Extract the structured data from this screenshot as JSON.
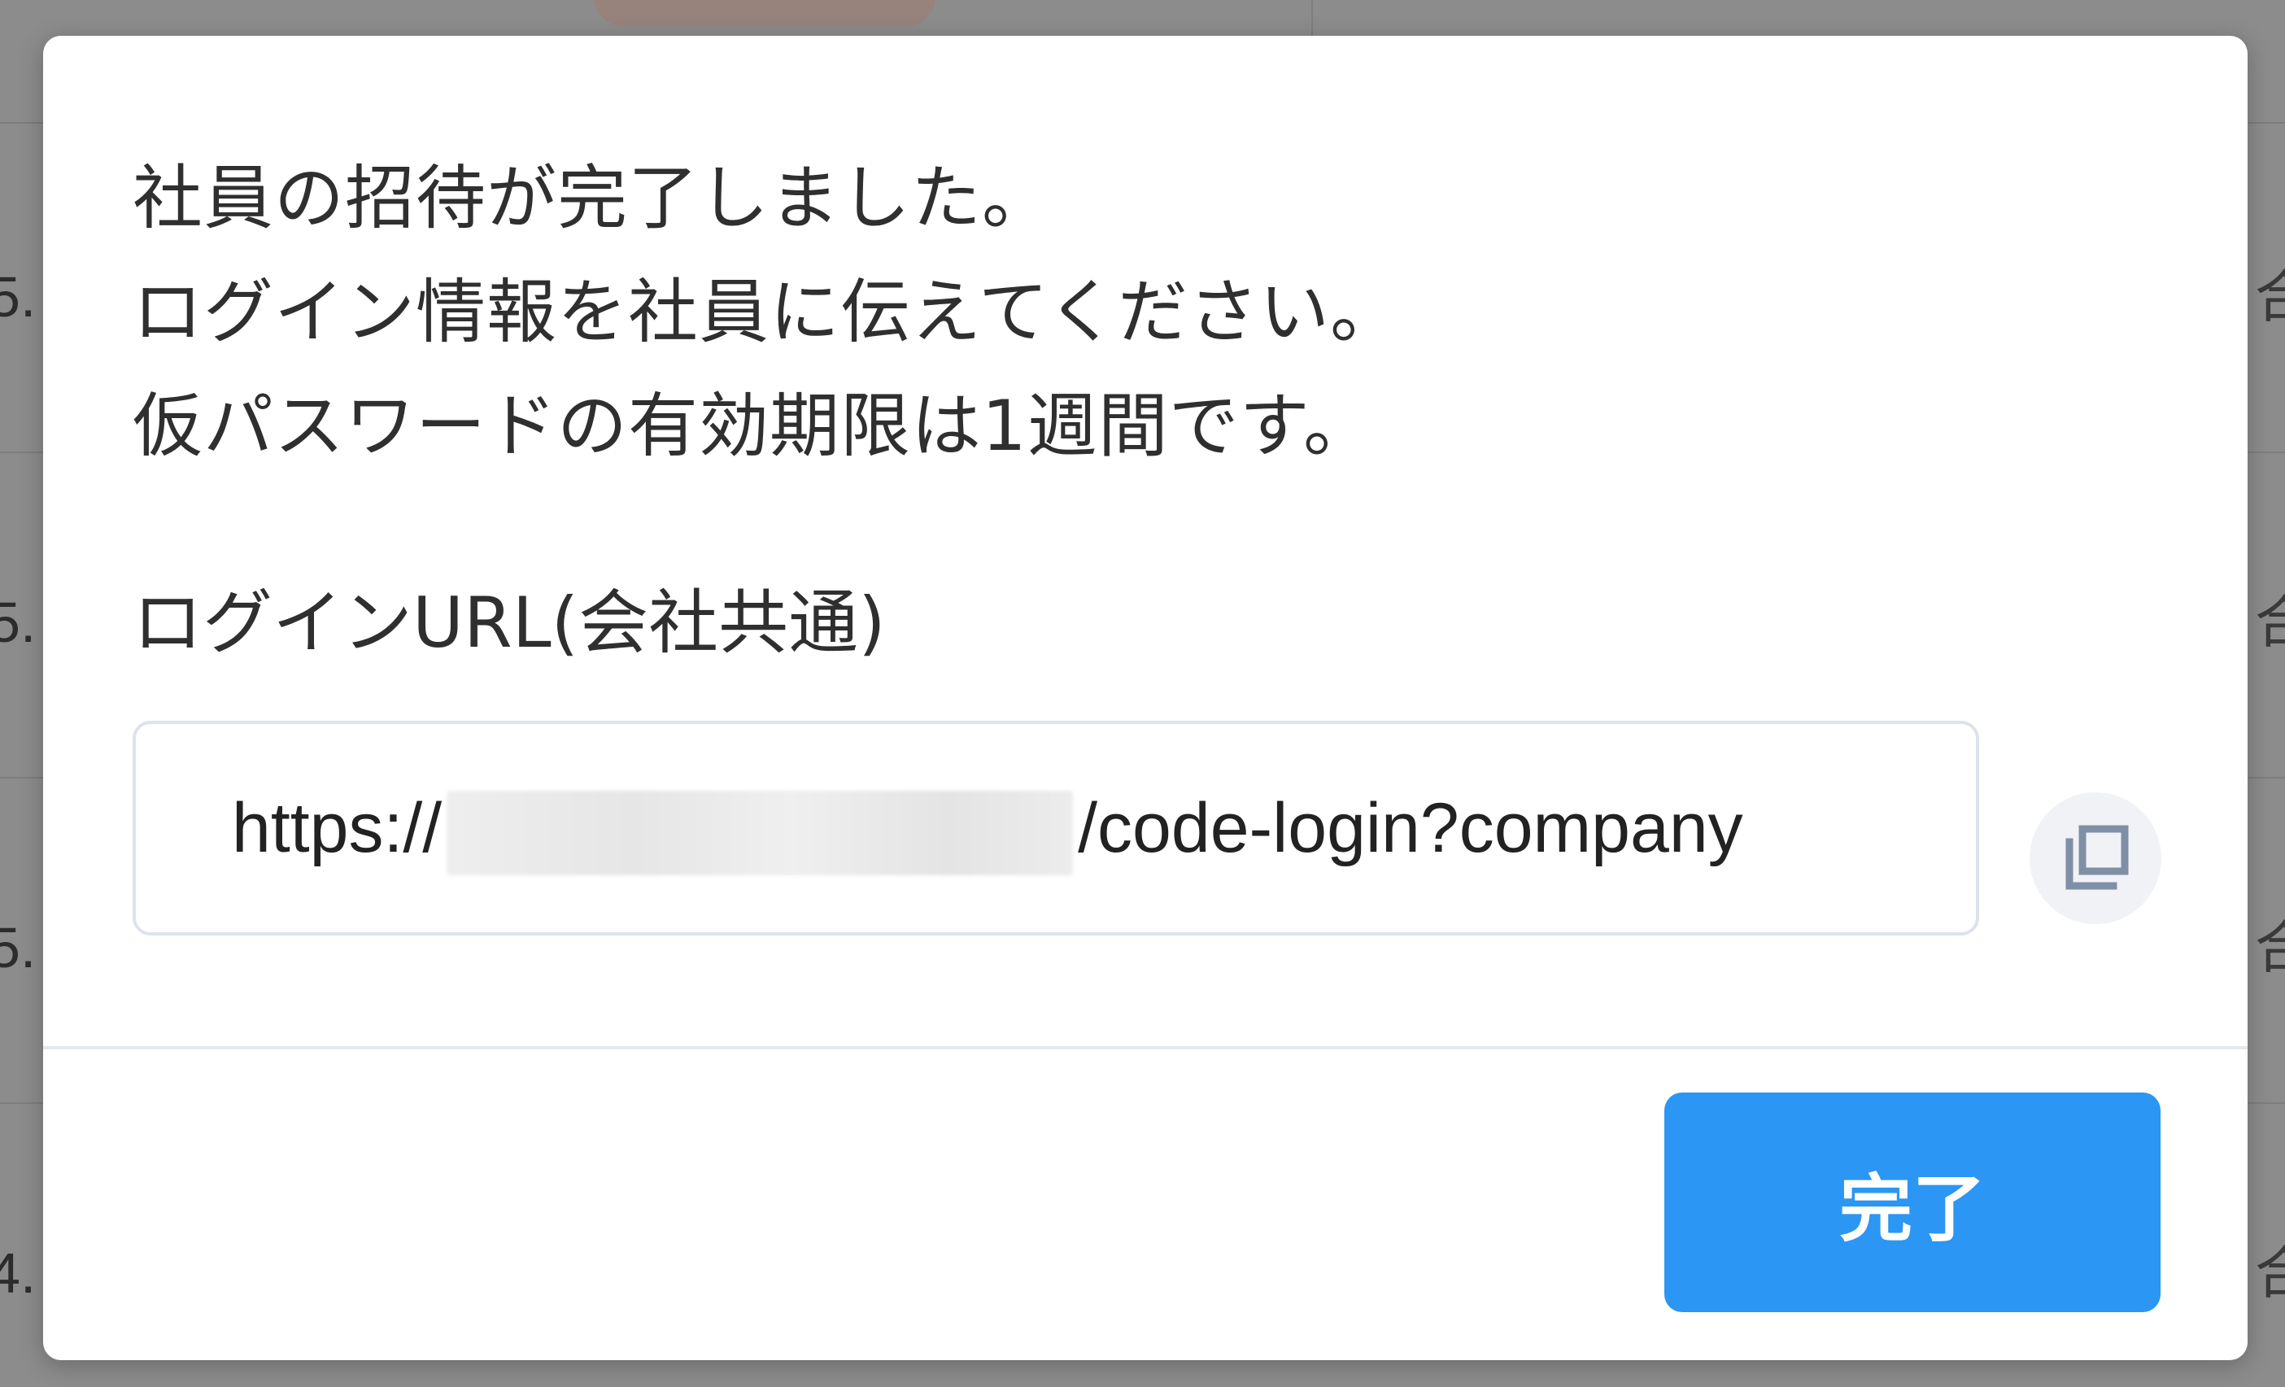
{
  "modal": {
    "message_lines": [
      "社員の招待が完了しました。",
      "ログイン情報を社員に伝えてください。",
      "仮パスワードの有効期限は1週間です。"
    ],
    "url_label": "ログインURL(会社共通)",
    "url_field": {
      "prefix": "https://",
      "suffix": "/code-login?company"
    },
    "copy_icon": "copy-icon",
    "done_label": "完了",
    "accent_color": "#2b96f3"
  },
  "background": {
    "left_column_texts": [
      "5.",
      "5.",
      "5.",
      "4."
    ],
    "right_column_texts": [
      "合",
      "合",
      "合",
      "合"
    ]
  }
}
